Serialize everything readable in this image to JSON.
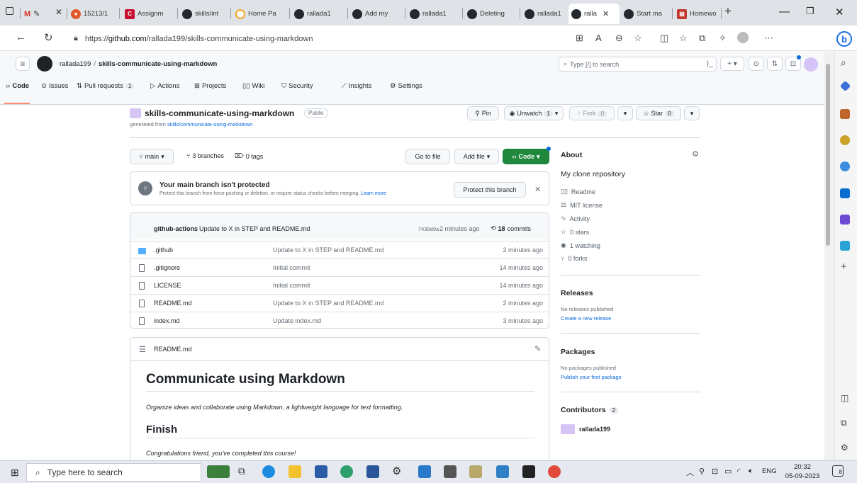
{
  "browser": {
    "tabs": [
      {
        "label": "M"
      },
      {
        "label": "15213/1"
      },
      {
        "label": "Assignm"
      },
      {
        "label": "skills/int"
      },
      {
        "label": "Home Pa"
      },
      {
        "label": "rallada1"
      },
      {
        "label": "Add my"
      },
      {
        "label": "rallada1"
      },
      {
        "label": "Deleting"
      },
      {
        "label": "rallada1"
      },
      {
        "label": "ralla"
      },
      {
        "label": "Start ma"
      },
      {
        "label": "Homewo"
      }
    ],
    "url_prefix": "https://",
    "url_host": "github.com",
    "url_path": "/rallada199/skills-communicate-using-markdown"
  },
  "gh": {
    "owner": "rallada199",
    "sep": "/",
    "repo": "skills-communicate-using-markdown",
    "search_placeholder": "Type [/] to search",
    "nav": [
      {
        "label": "Code"
      },
      {
        "label": "Issues"
      },
      {
        "label": "Pull requests",
        "count": "1"
      },
      {
        "label": "Actions"
      },
      {
        "label": "Projects"
      },
      {
        "label": "Wiki"
      },
      {
        "label": "Security"
      },
      {
        "label": "Insights"
      },
      {
        "label": "Settings"
      }
    ]
  },
  "repo": {
    "title": "skills-communicate-using-markdown",
    "visibility": "Public",
    "generated_from_prefix": "generated from ",
    "generated_from_link": "skills/communicate-using-markdown",
    "pin": "Pin",
    "unwatch": "Unwatch",
    "unwatch_count": "1",
    "fork": "Fork",
    "fork_count": "0",
    "star": "Star",
    "star_count": "0"
  },
  "toolbar": {
    "branch": "main",
    "branches": "3 branches",
    "tags": "0 tags",
    "go_to_file": "Go to file",
    "add_file": "Add file",
    "code": "Code"
  },
  "protect": {
    "title": "Your main branch isn't protected",
    "desc": "Protect this branch from force pushing or deletion, or require status checks before merging.",
    "learn": "Learn more",
    "button": "Protect this branch"
  },
  "commit": {
    "author": "github-actions",
    "message": "Update to X in STEP and README.md",
    "sha": "7438d9a",
    "time": "2 minutes ago",
    "commits_count": "18",
    "commits_label": "commits"
  },
  "files": [
    {
      "name": ".github",
      "msg": "Update to X in STEP and README.md",
      "time": "2 minutes ago",
      "type": "folder"
    },
    {
      "name": ".gitignore",
      "msg": "Initial commit",
      "time": "14 minutes ago",
      "type": "file"
    },
    {
      "name": "LICENSE",
      "msg": "Initial commit",
      "time": "14 minutes ago",
      "type": "file"
    },
    {
      "name": "README.md",
      "msg": "Update to X in STEP and README.md",
      "time": "2 minutes ago",
      "type": "file"
    },
    {
      "name": "index.md",
      "msg": "Update index.md",
      "time": "3 minutes ago",
      "type": "file"
    }
  ],
  "readme": {
    "filename": "README.md",
    "h1": "Communicate using Markdown",
    "intro": "Organize ideas and collaborate using Markdown, a lightweight language for text formatting.",
    "h2": "Finish",
    "congrats": "Congratulations friend, you've completed this course!"
  },
  "about": {
    "heading": "About",
    "description": "My clone repository",
    "items": [
      "Readme",
      "MIT license",
      "Activity",
      "0 stars",
      "1 watching",
      "0 forks"
    ]
  },
  "releases": {
    "heading": "Releases",
    "none": "No releases published",
    "create": "Create a new release"
  },
  "packages": {
    "heading": "Packages",
    "none": "No packages published",
    "publish": "Publish your first package"
  },
  "contributors": {
    "heading": "Contributors",
    "count": "2",
    "user": "rallada199"
  },
  "taskbar": {
    "search_placeholder": "Type here to search",
    "lang": "ENG",
    "time": "20:32",
    "date": "05-09-2023",
    "notif_count": "8"
  }
}
